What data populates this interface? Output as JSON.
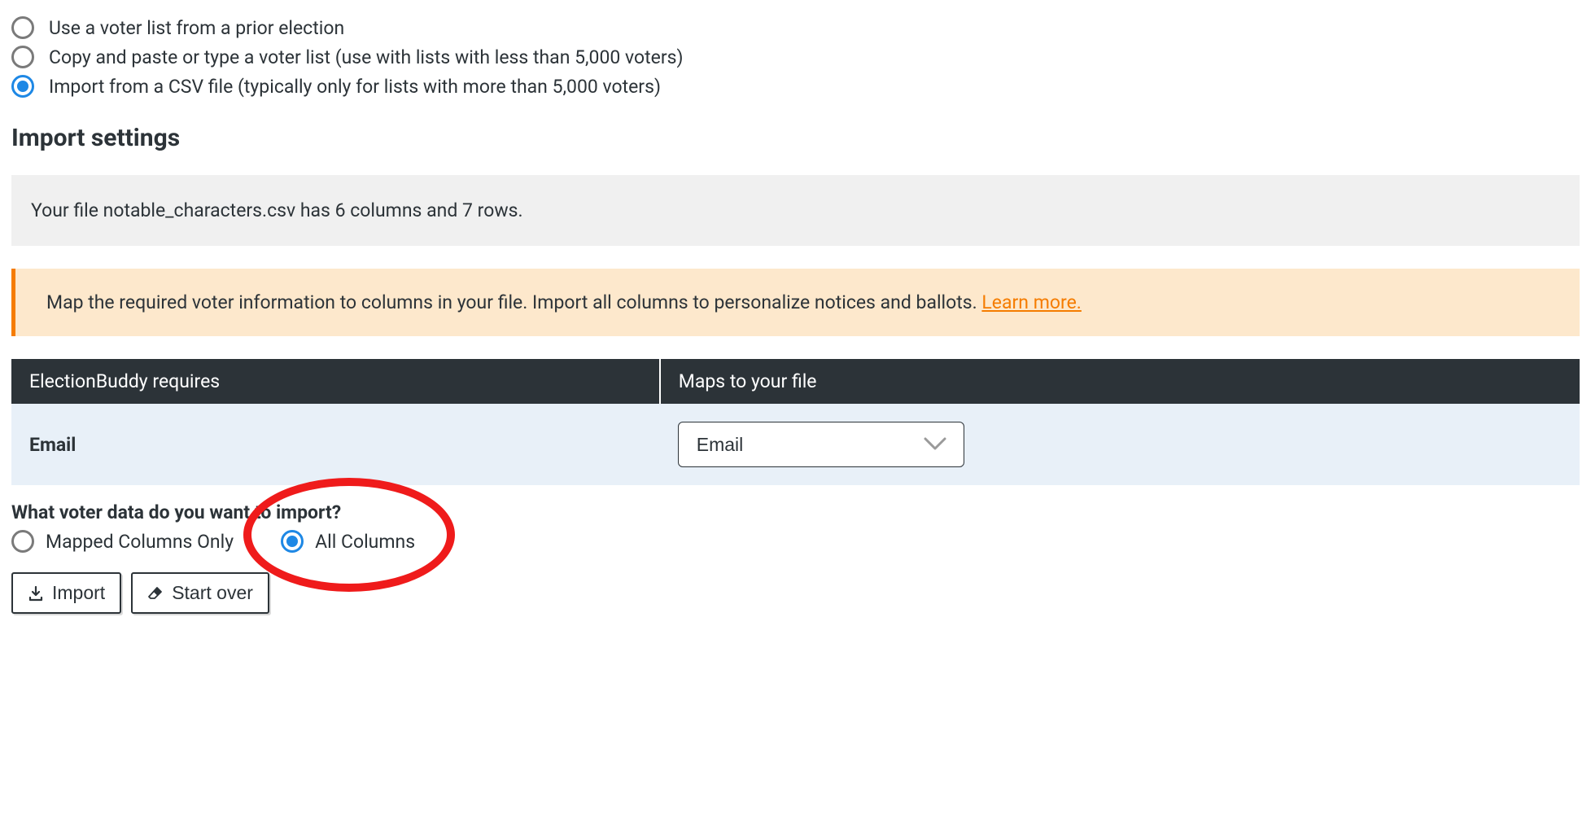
{
  "voter_source_options": [
    {
      "label": "Use a voter list from a prior election",
      "selected": false
    },
    {
      "label": "Copy and paste or type a voter list (use with lists with less than 5,000 voters)",
      "selected": false
    },
    {
      "label": "Import from a CSV file (typically only for lists with more than 5,000 voters)",
      "selected": true
    }
  ],
  "import_settings": {
    "heading": "Import settings",
    "file_info": "Your file notable_characters.csv has 6 columns and 7 rows.",
    "map_instruction": "Map the required voter information to columns in your file. Import all columns to personalize notices and ballots. ",
    "learn_more": "Learn more."
  },
  "mapping_table": {
    "header_required": "ElectionBuddy requires",
    "header_maps": "Maps to your file",
    "rows": [
      {
        "required": "Email",
        "selected": "Email"
      }
    ]
  },
  "import_scope": {
    "question": "What voter data do you want to import?",
    "options": [
      {
        "label": "Mapped Columns Only",
        "selected": false
      },
      {
        "label": "All Columns",
        "selected": true
      }
    ]
  },
  "buttons": {
    "import": "Import",
    "start_over": "Start over"
  }
}
